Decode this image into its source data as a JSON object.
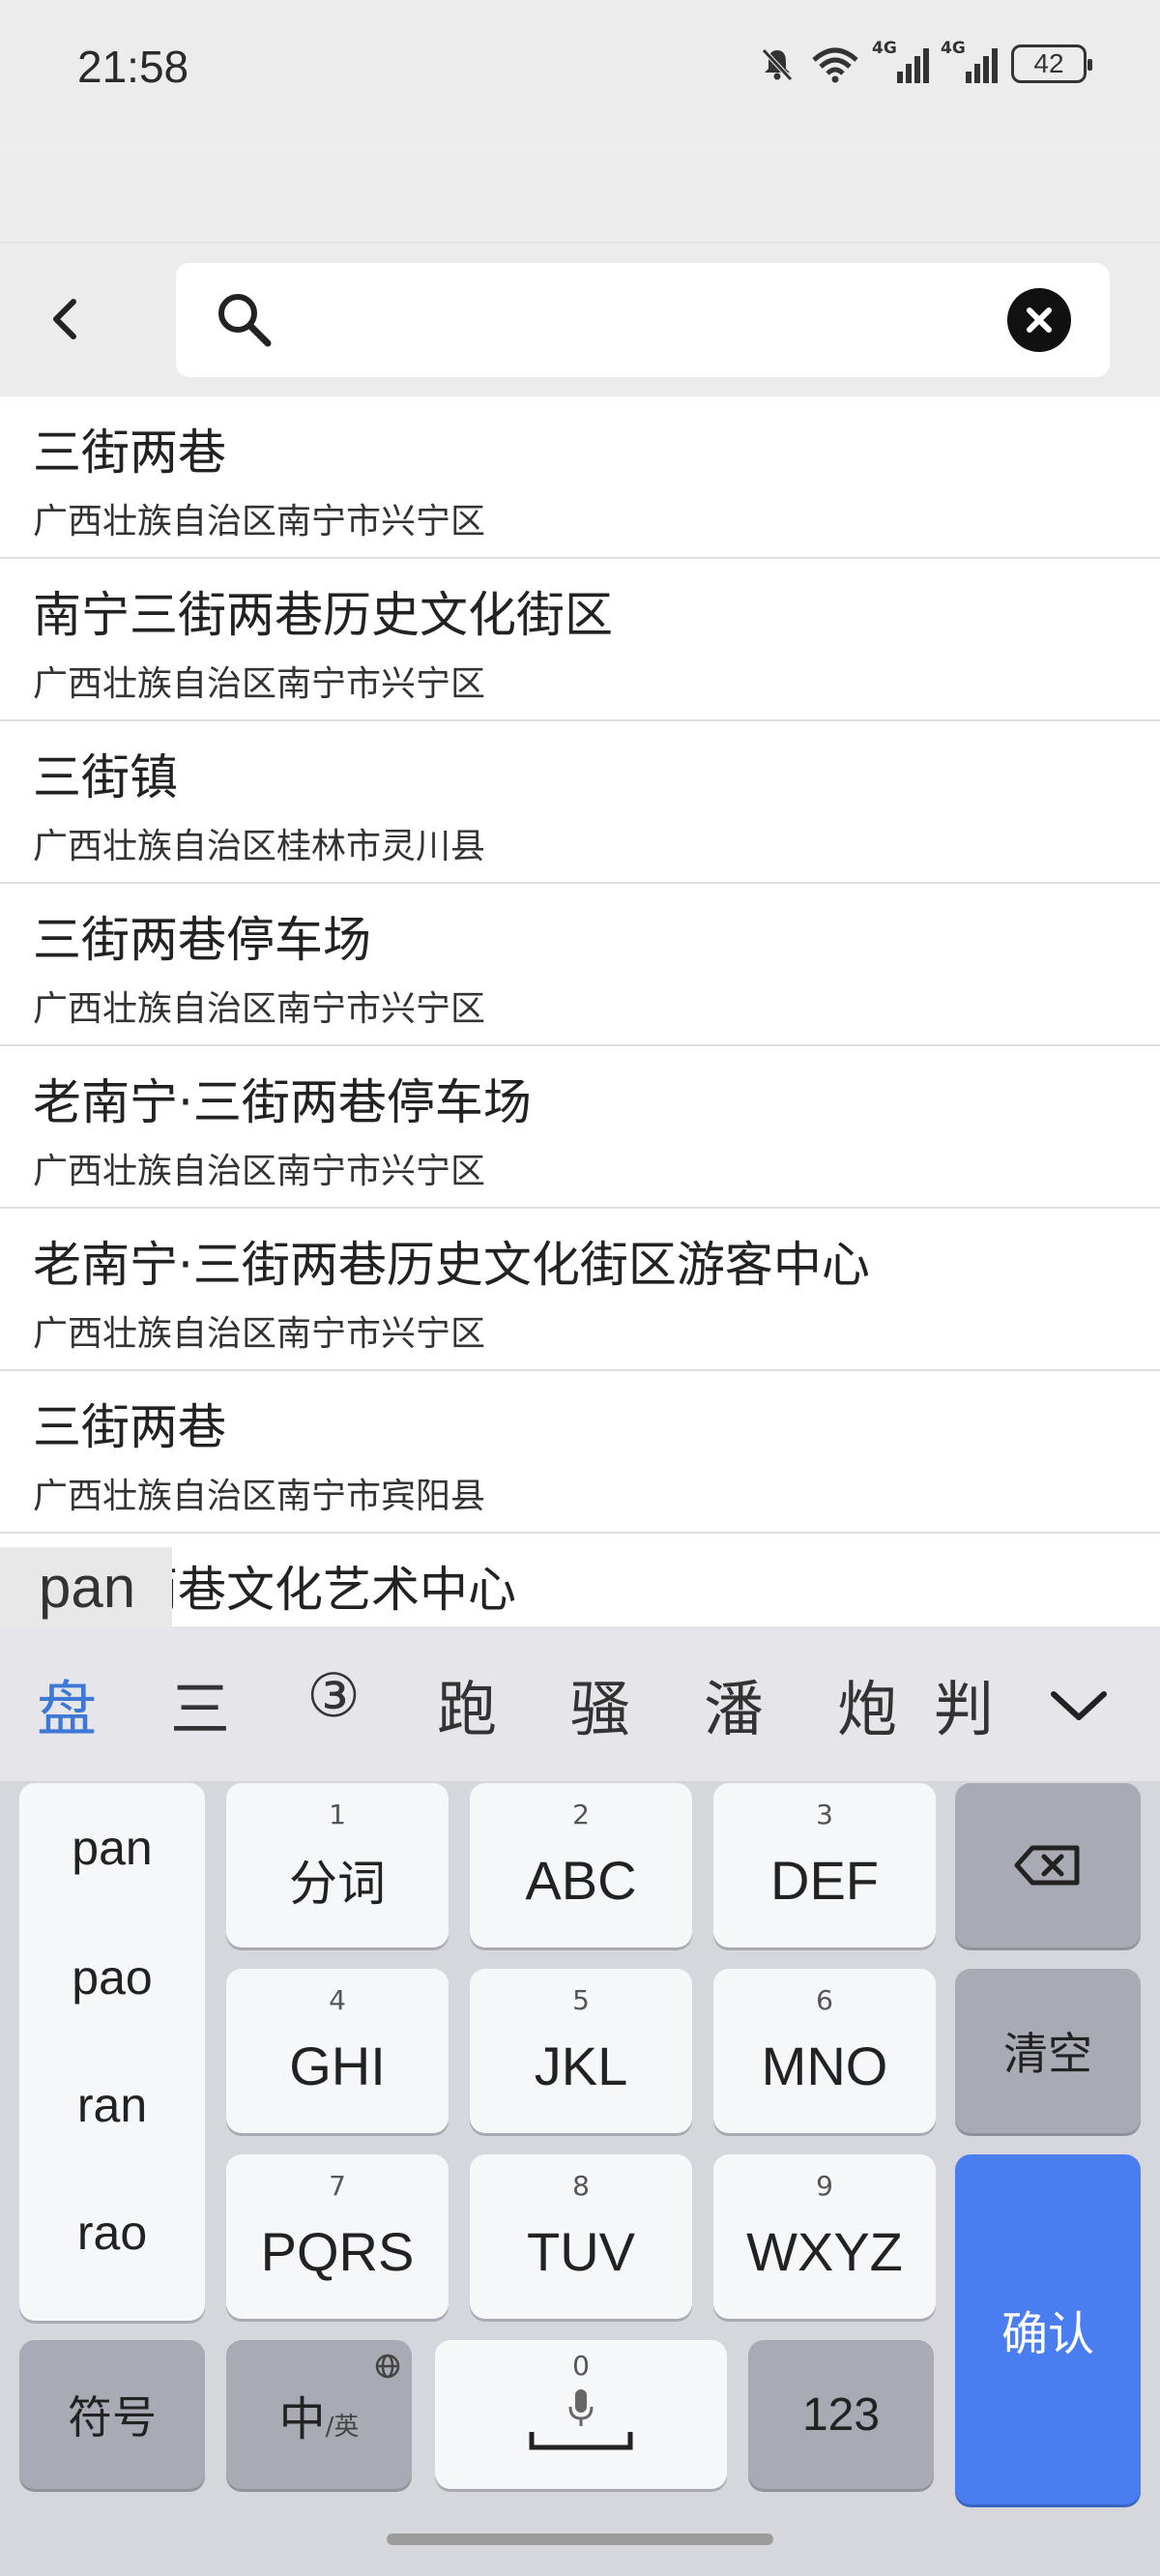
{
  "status": {
    "time": "21:58",
    "battery": "42",
    "network_1": "4G",
    "network_2": "4G"
  },
  "search": {
    "value": "",
    "placeholder": ""
  },
  "results": [
    {
      "title": "三街两巷",
      "subtitle": "广西壮族自治区南宁市兴宁区"
    },
    {
      "title": "南宁三街两巷历史文化街区",
      "subtitle": "广西壮族自治区南宁市兴宁区"
    },
    {
      "title": "三街镇",
      "subtitle": "广西壮族自治区桂林市灵川县"
    },
    {
      "title": "三街两巷停车场",
      "subtitle": "广西壮族自治区南宁市兴宁区"
    },
    {
      "title": "老南宁·三街两巷停车场",
      "subtitle": "广西壮族自治区南宁市兴宁区"
    },
    {
      "title": "老南宁·三街两巷历史文化街区游客中心",
      "subtitle": "广西壮族自治区南宁市兴宁区"
    },
    {
      "title": "三街两巷",
      "subtitle": "广西壮族自治区南宁市宾阳县"
    },
    {
      "title": "三街两巷文化艺术中心",
      "subtitle": ""
    }
  ],
  "ime": {
    "composing": "pan",
    "candidates": [
      "盘",
      "三",
      "③",
      "跑",
      "骚",
      "潘",
      "炮",
      "判"
    ],
    "pinyin_options": [
      "pan",
      "pao",
      "ran",
      "rao"
    ],
    "keys": {
      "k1_num": "1",
      "k1_label": "分词",
      "k2_num": "2",
      "k2_label": "ABC",
      "k3_num": "3",
      "k3_label": "DEF",
      "k4_num": "4",
      "k4_label": "GHI",
      "k5_num": "5",
      "k5_label": "JKL",
      "k6_num": "6",
      "k6_label": "MNO",
      "k7_num": "7",
      "k7_label": "PQRS",
      "k8_num": "8",
      "k8_label": "TUV",
      "k9_num": "9",
      "k9_label": "WXYZ",
      "k0_num": "0",
      "clear_label": "清空",
      "confirm_label": "确认",
      "symbol_label": "符号",
      "lang_main": "中",
      "lang_sub": "/英",
      "num_label": "123"
    },
    "accent_color": "#4a7ef0",
    "candidate_highlight": "#3d78d6"
  }
}
